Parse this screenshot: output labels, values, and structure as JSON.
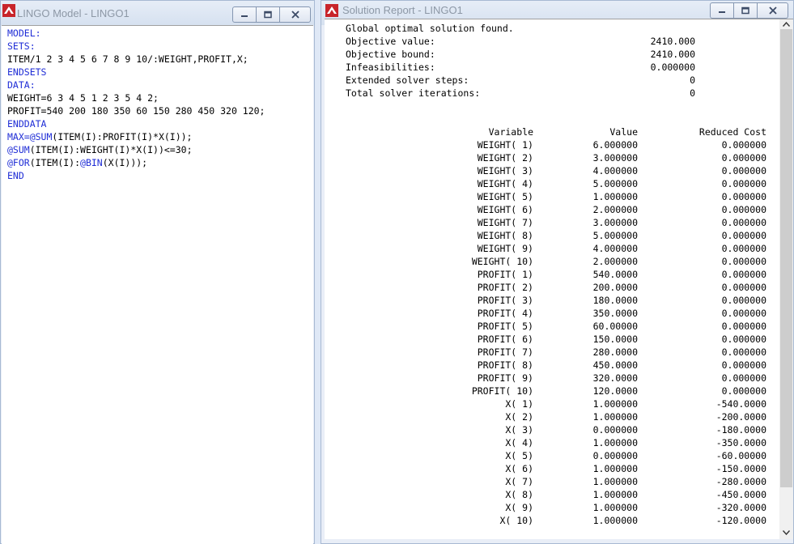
{
  "model_window": {
    "title": "LINGO Model - LINGO1",
    "code_lines": [
      [
        {
          "t": "MODEL:",
          "kw": true
        }
      ],
      [
        {
          "t": "SETS:",
          "kw": true
        }
      ],
      [
        {
          "t": "ITEM/1 2 3 4 5 6 7 8 9 10/:WEIGHT,PROFIT,X;",
          "kw": false
        }
      ],
      [
        {
          "t": "ENDSETS",
          "kw": true
        }
      ],
      [
        {
          "t": "DATA:",
          "kw": true
        }
      ],
      [
        {
          "t": "WEIGHT=6 3 4 5 1 2 3 5 4 2;",
          "kw": false
        }
      ],
      [
        {
          "t": "PROFIT=540 200 180 350 60 150 280 450 320 120;",
          "kw": false
        }
      ],
      [
        {
          "t": "ENDDATA",
          "kw": true
        }
      ],
      [
        {
          "t": "MAX=@SUM",
          "kw": true
        },
        {
          "t": "(ITEM(I):PROFIT(I)*X(I));",
          "kw": false
        }
      ],
      [
        {
          "t": "@SUM",
          "kw": true
        },
        {
          "t": "(ITEM(I):WEIGHT(I)*X(I))<=30;",
          "kw": false
        }
      ],
      [
        {
          "t": "@FOR",
          "kw": true
        },
        {
          "t": "(ITEM(I):",
          "kw": false
        },
        {
          "t": "@BIN",
          "kw": true
        },
        {
          "t": "(X(I)));",
          "kw": false
        }
      ],
      [
        {
          "t": "END",
          "kw": true
        }
      ]
    ]
  },
  "report_window": {
    "title": "Solution Report - LINGO1",
    "status": "Global optimal solution found.",
    "summary": [
      {
        "label": "Objective value:",
        "value": "2410.000"
      },
      {
        "label": "Objective bound:",
        "value": "2410.000"
      },
      {
        "label": "Infeasibilities:",
        "value": "0.000000"
      },
      {
        "label": "Extended solver steps:",
        "value": "0"
      },
      {
        "label": "Total solver iterations:",
        "value": "0"
      }
    ],
    "columns": [
      "Variable",
      "Value",
      "Reduced Cost"
    ],
    "rows": [
      [
        "WEIGHT( 1)",
        "6.000000",
        "0.000000"
      ],
      [
        "WEIGHT( 2)",
        "3.000000",
        "0.000000"
      ],
      [
        "WEIGHT( 3)",
        "4.000000",
        "0.000000"
      ],
      [
        "WEIGHT( 4)",
        "5.000000",
        "0.000000"
      ],
      [
        "WEIGHT( 5)",
        "1.000000",
        "0.000000"
      ],
      [
        "WEIGHT( 6)",
        "2.000000",
        "0.000000"
      ],
      [
        "WEIGHT( 7)",
        "3.000000",
        "0.000000"
      ],
      [
        "WEIGHT( 8)",
        "5.000000",
        "0.000000"
      ],
      [
        "WEIGHT( 9)",
        "4.000000",
        "0.000000"
      ],
      [
        "WEIGHT( 10)",
        "2.000000",
        "0.000000"
      ],
      [
        "PROFIT( 1)",
        "540.0000",
        "0.000000"
      ],
      [
        "PROFIT( 2)",
        "200.0000",
        "0.000000"
      ],
      [
        "PROFIT( 3)",
        "180.0000",
        "0.000000"
      ],
      [
        "PROFIT( 4)",
        "350.0000",
        "0.000000"
      ],
      [
        "PROFIT( 5)",
        "60.00000",
        "0.000000"
      ],
      [
        "PROFIT( 6)",
        "150.0000",
        "0.000000"
      ],
      [
        "PROFIT( 7)",
        "280.0000",
        "0.000000"
      ],
      [
        "PROFIT( 8)",
        "450.0000",
        "0.000000"
      ],
      [
        "PROFIT( 9)",
        "320.0000",
        "0.000000"
      ],
      [
        "PROFIT( 10)",
        "120.0000",
        "0.000000"
      ],
      [
        "X( 1)",
        "1.000000",
        "-540.0000"
      ],
      [
        "X( 2)",
        "1.000000",
        "-200.0000"
      ],
      [
        "X( 3)",
        "0.000000",
        "-180.0000"
      ],
      [
        "X( 4)",
        "1.000000",
        "-350.0000"
      ],
      [
        "X( 5)",
        "0.000000",
        "-60.00000"
      ],
      [
        "X( 6)",
        "1.000000",
        "-150.0000"
      ],
      [
        "X( 7)",
        "1.000000",
        "-280.0000"
      ],
      [
        "X( 8)",
        "1.000000",
        "-450.0000"
      ],
      [
        "X( 9)",
        "1.000000",
        "-320.0000"
      ],
      [
        "X( 10)",
        "1.000000",
        "-120.0000"
      ]
    ]
  },
  "icons": {
    "app": "lingo-app-icon",
    "minimize": "minimize-icon",
    "restore": "restore-icon",
    "close": "close-icon",
    "scroll_up": "scroll-up-arrow-icon",
    "scroll_down": "scroll-down-arrow-icon"
  },
  "colors": {
    "keyword": "#1f2dd6",
    "title_text": "#8d98a6",
    "frame": "#dfe8f6",
    "icon_red": "#c8242a"
  }
}
